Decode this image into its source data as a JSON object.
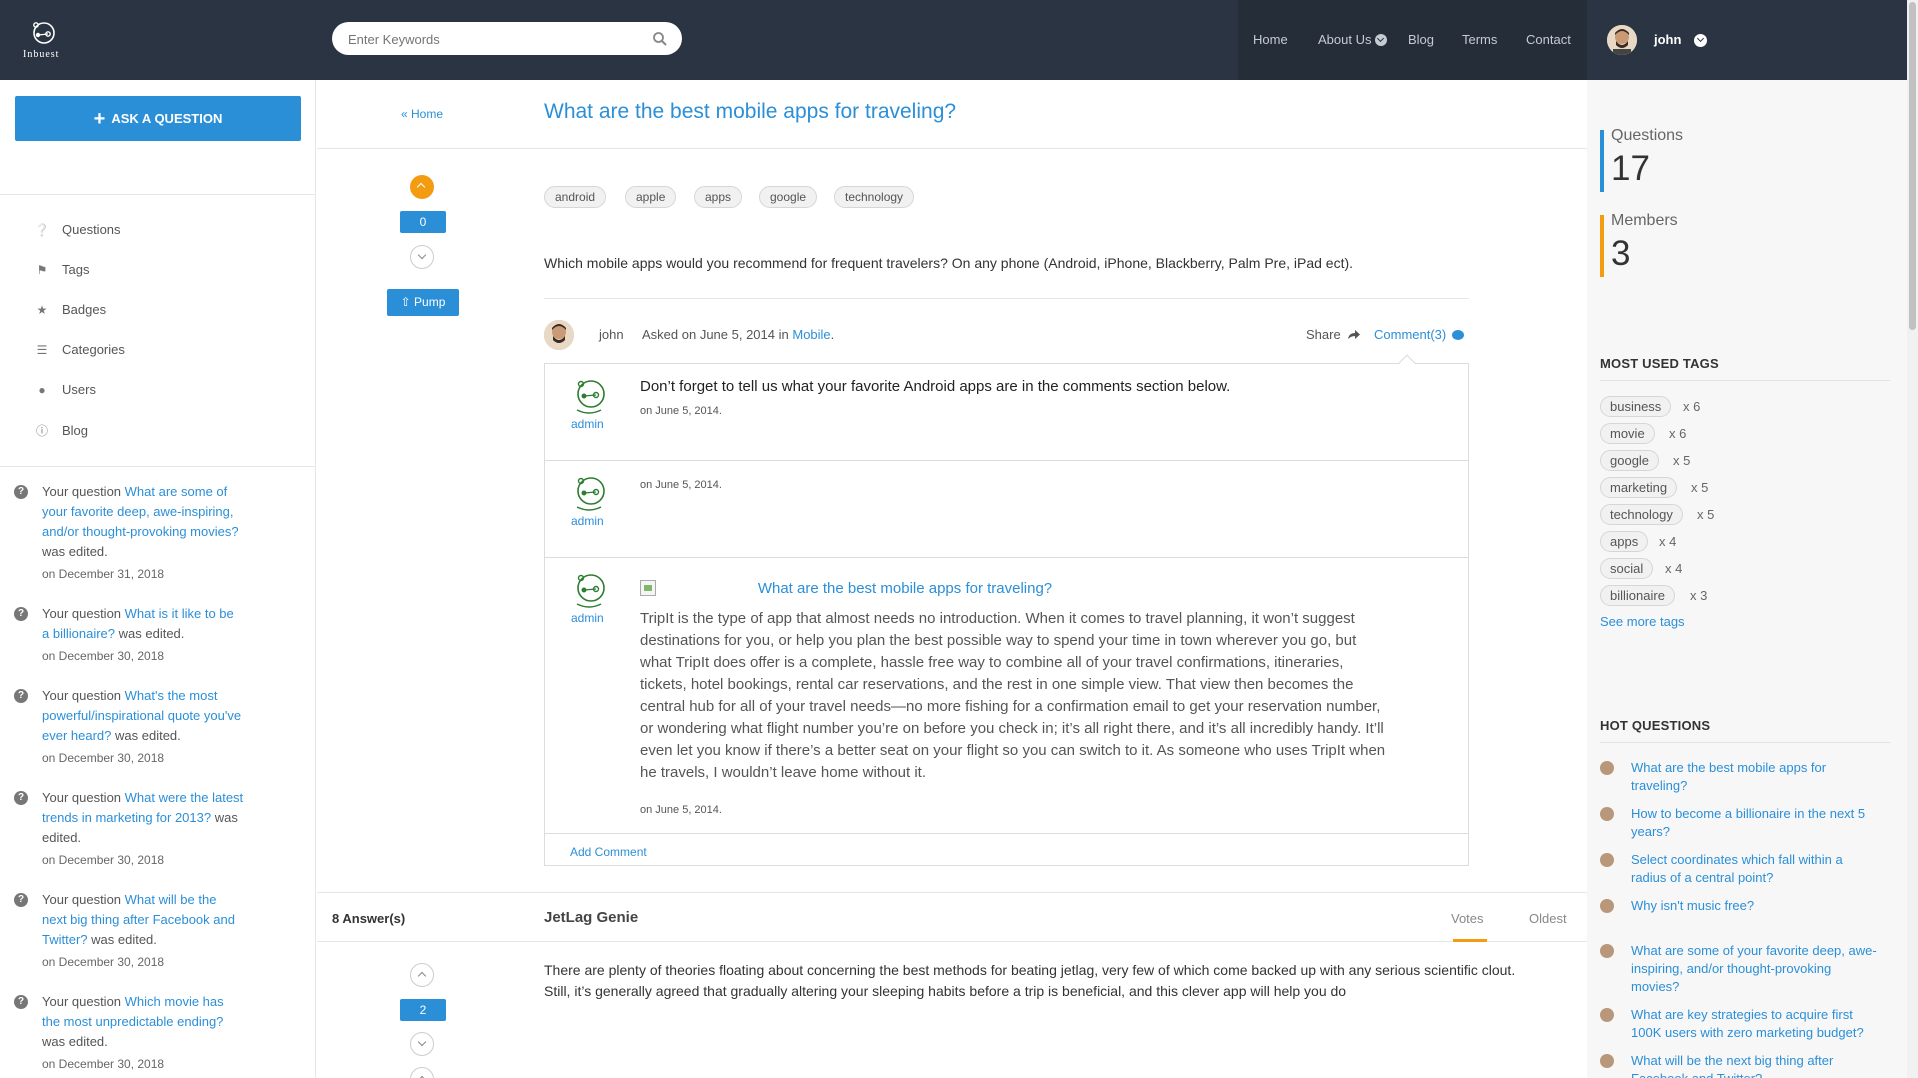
{
  "header": {
    "logo_text": "Inbuest",
    "search": {
      "placeholder": "Enter Keywords"
    },
    "nav": [
      "Home",
      "About Us",
      "Blog",
      "Terms",
      "Contact"
    ],
    "user": "john"
  },
  "left": {
    "ask_button": "ASK A QUESTION",
    "menu": [
      {
        "label": "Questions",
        "icon": "question-circle-icon"
      },
      {
        "label": "Tags",
        "icon": "tags-icon"
      },
      {
        "label": "Badges",
        "icon": "trophy-icon"
      },
      {
        "label": "Categories",
        "icon": "list-icon"
      },
      {
        "label": "Users",
        "icon": "users-icon"
      },
      {
        "label": "Blog",
        "icon": "info-circle-icon"
      }
    ],
    "activity": [
      {
        "prefix": "Your question",
        "link": "What are some of your favorite deep, awe-inspiring, and/or thought-provoking movies?",
        "suffix": "was edited.",
        "date": "on December 31, 2018"
      },
      {
        "prefix": "Your question",
        "link": "What is it like to be a billionaire?",
        "suffix": "was edited.",
        "date": "on December 30, 2018"
      },
      {
        "prefix": "Your question",
        "link": "What's the most powerful/inspirational quote you've ever heard?",
        "suffix": "was edited.",
        "date": "on December 30, 2018"
      },
      {
        "prefix": "Your question",
        "link": "What were the latest trends in marketing for 2013?",
        "suffix": "was edited.",
        "date": "on December 30, 2018"
      },
      {
        "prefix": "Your question",
        "link": "What will be the next big thing after Facebook and Twitter?",
        "suffix": "was edited.",
        "date": "on December 30, 2018"
      },
      {
        "prefix": "Your question",
        "link": "Which movie has the most unpredictable ending?",
        "suffix": "was edited.",
        "date": "on December 30, 2018"
      }
    ]
  },
  "question": {
    "breadcrumb": "Home",
    "title": "What are the best mobile apps for traveling?",
    "votes": "0",
    "pump_label": "Pump",
    "tags": [
      "android",
      "apple",
      "apps",
      "google",
      "technology"
    ],
    "body": "Which mobile apps would you recommend for frequent travelers? On any phone (Android, iPhone, Blackberry, Palm Pre, iPad ect).",
    "author": "john",
    "asked_prefix": "Asked on June 5, 2014 in",
    "category": "Mobile",
    "share_label": "Share",
    "comment_label": "Comment(3)"
  },
  "comments": [
    {
      "user": "admin",
      "text": "Don’t forget to tell us what your favorite Android apps are in the comments section below.",
      "date": "on June 5, 2014."
    },
    {
      "user": "admin",
      "text": "",
      "date": "on June 5, 2014."
    },
    {
      "user": "admin",
      "link": "What are the best mobile apps for traveling?",
      "text": "TripIt is the type of app that almost needs no introduction. When it comes to travel planning, it won’t suggest destinations for you, or help you plan the best possible way to spend your time in town wherever you go, but what TripIt does offer is a complete, hassle free way to combine all of your travel confirmations, itineraries, tickets, hotel bookings, rental car reservations, and the rest in one simple view. That view then becomes the central hub for all of your travel needs—no more fishing for a confirmation email to get your reservation number, or wondering what flight number you’re on before you check in; it’s all right there, and it’s all incredibly handy. It’ll even let you know if there’s a better seat on your flight so you can switch to it. As someone who uses TripIt when he travels, I wouldn’t leave home without it.",
      "date": "on June 5, 2014."
    }
  ],
  "add_comment": "Add Comment",
  "answers": {
    "count_label": "8 Answer(s)",
    "tabs": [
      "Votes",
      "Oldest"
    ],
    "first": {
      "votes": "2",
      "title": "JetLag Genie",
      "body": "There are plenty of theories floating about concerning the best methods for beating jetlag, very few of which come backed up with any serious scientific clout. Still, it’s generally agreed that gradually altering your sleeping habits before a trip is beneficial, and this clever app will help you do"
    }
  },
  "right": {
    "stats": [
      {
        "label": "Questions",
        "value": "17",
        "color": "#2b8fd8"
      },
      {
        "label": "Members",
        "value": "3",
        "color": "#f39c12"
      }
    ],
    "tags_title": "MOST USED TAGS",
    "tags": [
      {
        "name": "business",
        "count": "x 6"
      },
      {
        "name": "movie",
        "count": "x 6"
      },
      {
        "name": "google",
        "count": "x 5"
      },
      {
        "name": "marketing",
        "count": "x 5"
      },
      {
        "name": "technology",
        "count": "x 5"
      },
      {
        "name": "apps",
        "count": "x 4"
      },
      {
        "name": "social",
        "count": "x 4"
      },
      {
        "name": "billionaire",
        "count": "x 3"
      }
    ],
    "see_more": "See more tags",
    "hot_title": "HOT QUESTIONS",
    "hot": [
      "What are the best mobile apps for traveling?",
      "How to become a billionaire in the next 5 years?",
      "Select coordinates which fall within a radius of a central point?",
      "Why isn't music free?",
      "What are some of your favorite deep, awe-inspiring, and/or thought-provoking movies?",
      "What are key strategies to acquire first 100K users with zero marketing budget?",
      "What will be the next big thing after Facebook and Twitter?"
    ]
  }
}
